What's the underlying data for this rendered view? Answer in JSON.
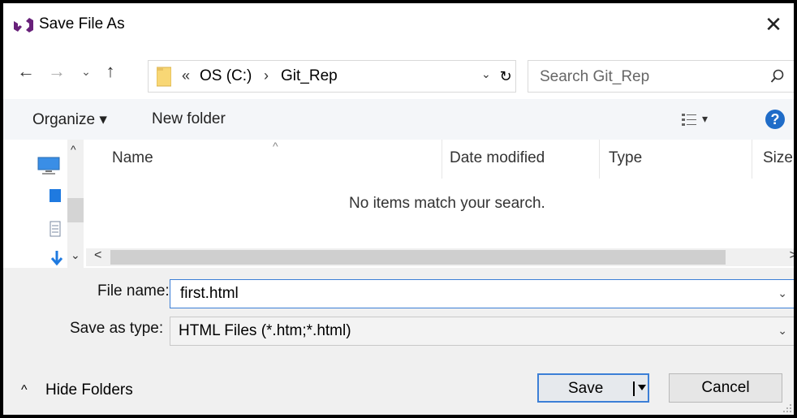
{
  "window": {
    "title": "Save File As",
    "close_glyph": "✕",
    "app_icon": "visual-studio-icon"
  },
  "nav": {
    "back_glyph": "←",
    "forward_glyph": "→",
    "recent_glyph": "⌄",
    "up_glyph": "↑",
    "address": {
      "overflow_glyph": "«",
      "crumbs": [
        "OS (C:)",
        "Git_Rep"
      ],
      "separator_glyph": "›",
      "dropdown_glyph": "⌄",
      "refresh_glyph": "↻"
    },
    "search": {
      "placeholder": "Search Git_Rep"
    }
  },
  "command_bar": {
    "organize_label": "Organize ▾",
    "new_folder_label": "New folder",
    "view_dropdown_glyph": "▾",
    "help_glyph": "?"
  },
  "file_list": {
    "columns": [
      "Name",
      "Date modified",
      "Type",
      "Size"
    ],
    "sort_glyph": "^",
    "empty_message": "No items match your search.",
    "scroll_left_glyph": "<",
    "scroll_right_glyph": ">"
  },
  "nav_pane": {
    "scroll_up_glyph": "^",
    "scroll_down_glyph": "⌄"
  },
  "form": {
    "file_name_label": "File name:",
    "file_name_value": "first.html",
    "save_type_label": "Save as type:",
    "save_type_value": "HTML Files (*.htm;*.html)",
    "combo_glyph": "⌄"
  },
  "footer": {
    "hide_folders_label": "Hide Folders",
    "hide_folders_glyph": "^",
    "save_label": "Save",
    "cancel_label": "Cancel"
  },
  "colors": {
    "accent": "#3c7fd6",
    "help_blue": "#1f6cc8",
    "visual_studio_purple": "#68217a",
    "folder_yellow": "#f8d775"
  }
}
